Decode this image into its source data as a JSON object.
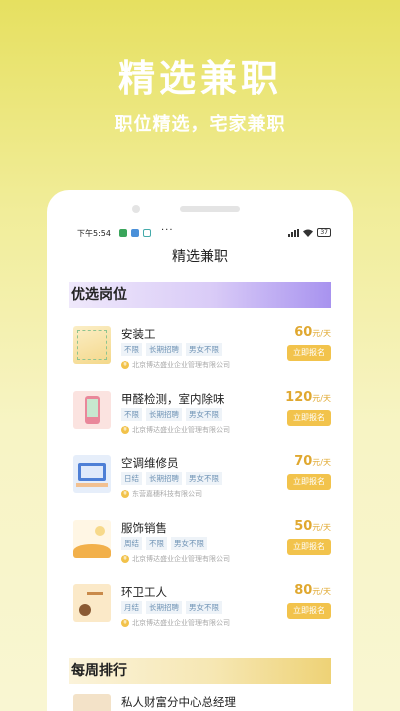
{
  "hero": {
    "title": "精选兼职",
    "subtitle": "职位精选，宅家兼职"
  },
  "status_bar": {
    "time": "下午5:54",
    "battery": "37",
    "dots": "···"
  },
  "app_title": "精选兼职",
  "sections": {
    "featured": "优选岗位",
    "weekly": "每周排行"
  },
  "jobs": [
    {
      "title": "安装工",
      "tags": [
        "不限",
        "长期招聘",
        "男女不限"
      ],
      "company": "北京博达盛业企业管理有限公司",
      "salary": "60",
      "unit": "元/天",
      "apply": "立即报名"
    },
    {
      "title": "甲醛检测，室内除味",
      "tags": [
        "不限",
        "长期招聘",
        "男女不限"
      ],
      "company": "北京博达盛业企业管理有限公司",
      "salary": "120",
      "unit": "元/天",
      "apply": "立即报名"
    },
    {
      "title": "空调维修员",
      "tags": [
        "日结",
        "长期招聘",
        "男女不限"
      ],
      "company": "东营嘉穗科技有限公司",
      "salary": "70",
      "unit": "元/天",
      "apply": "立即报名"
    },
    {
      "title": "服饰销售",
      "tags": [
        "周结",
        "不限",
        "男女不限"
      ],
      "company": "北京博达盛业企业管理有限公司",
      "salary": "50",
      "unit": "元/天",
      "apply": "立即报名"
    },
    {
      "title": "环卫工人",
      "tags": [
        "月结",
        "长期招聘",
        "男女不限"
      ],
      "company": "北京博达盛业企业管理有限公司",
      "salary": "80",
      "unit": "元/天",
      "apply": "立即报名"
    }
  ],
  "weekly_first": {
    "title": "私人财富分中心总经理"
  },
  "colors": {
    "accent": "#f2c34c",
    "salary": "#e0a830",
    "tag_text": "#6f93b5"
  }
}
